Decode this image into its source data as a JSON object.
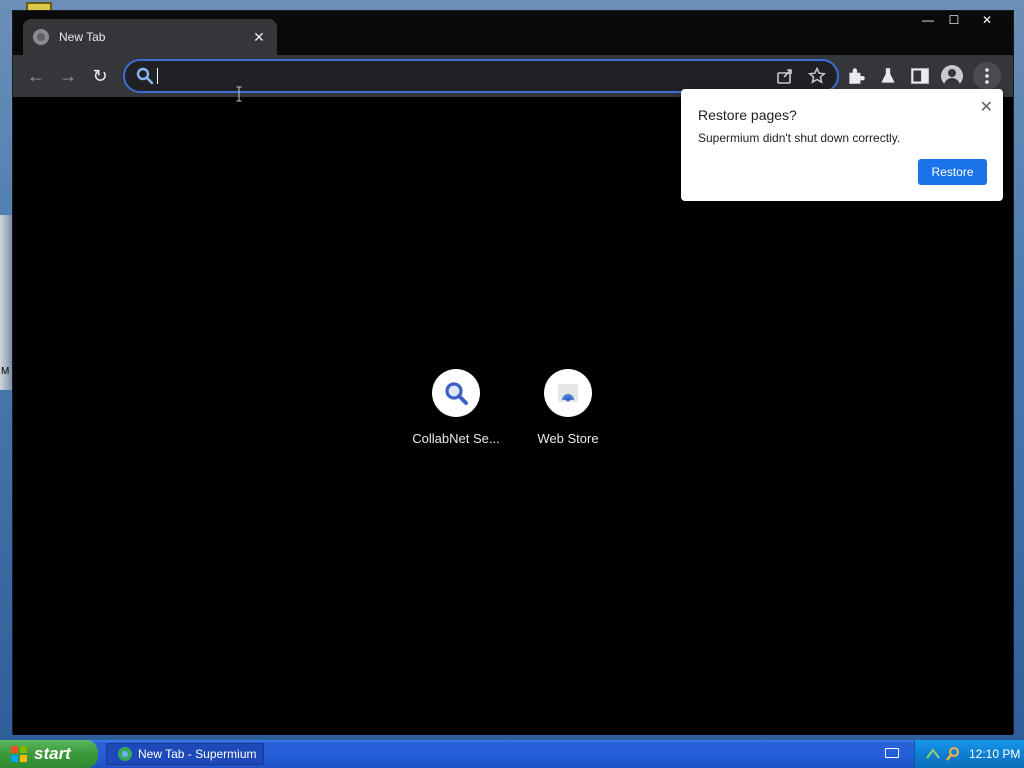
{
  "browser": {
    "tab": {
      "title": "New Tab",
      "close": "✕"
    },
    "window_controls": {
      "minimize": "—",
      "maximize": "☐",
      "close": "✕"
    },
    "toolbar": {
      "back": "←",
      "forward": "→",
      "reload": "↻",
      "omnibox": {
        "value": "",
        "placeholder": ""
      }
    },
    "shortcuts": [
      {
        "label": "CollabNet Se..."
      },
      {
        "label": "Web Store"
      }
    ],
    "restore_popup": {
      "title": "Restore pages?",
      "message": "Supermium didn't shut down correctly.",
      "button": "Restore",
      "close": "✕"
    }
  },
  "taskbar": {
    "start_label": "start",
    "task_label": "New Tab - Supermium",
    "clock": "12:10 PM"
  },
  "desktop": {
    "edge_letter": "M"
  },
  "colors": {
    "accent": "#1a73e8",
    "omnibox_border": "#3b6fd8",
    "toolbar_bg": "#35363a",
    "taskbar_blue": "#245edb",
    "start_green": "#3c9a3c"
  }
}
